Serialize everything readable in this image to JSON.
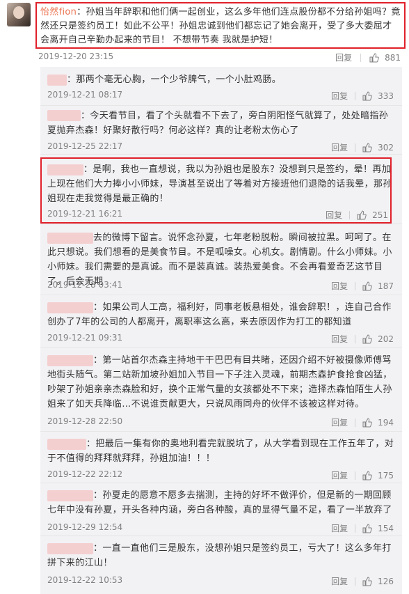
{
  "main_comment": {
    "username": "怡然fion",
    "colon": "：",
    "text": "孙姐当年辞职和他们俩一起创业，这么多年他们连点股份都不分给孙姐吗？竟然还只是签约员工！如此不公平！孙姐忠诚到他们都忘记了她会离开，受了多大委屈才会离开自己辛勤办起来的节目！ 不想带节奏 我就是护短！",
    "date": "2019-12-20 23:15",
    "reply_label": "回复",
    "likes": "881"
  },
  "replies": [
    {
      "text": "：那两个毫无心胸，一个少爷脾气，一个小肚鸡肠。",
      "date": "2019-12-21 08:17",
      "reply_label": "回复",
      "likes": "333"
    },
    {
      "text": "：今天看节目，看了个头就看不下去了，旁白阴阳怪气就算了，处处暗指孙夏抛弃杰森！好聚好散行吗？何必这样？真的让老粉太伤心了",
      "date": "2019-12-25 22:17",
      "reply_label": "回复",
      "likes": "302"
    },
    {
      "text": "：是啊，我也一直想说，我以为孙姐也是股东？没想到只是签约，晕！再加上现在他们大力捧小小师妹，导演甚至说出了等着对方接班他们退隐的话我晕，那孙姐现在走我觉得是最正确的！",
      "date": "2019-12-21 16:21",
      "reply_label": "回复",
      "likes": "251"
    },
    {
      "text": "去的微博下留言。说怀念孙夏，七年老粉脱粉。瞬间被拉黑。呵呵了。在此只想说。我们想看的是美食节目。不是呱噪女。心机女。剧情剧。什么小师妹。小小师妹。我们需要的是真诚。而不是装真诚。装热爱美食。不会再看爱奇艺这节目了。后会无期",
      "date": "2019-12-28 03:41",
      "reply_label": "回复",
      "likes": "187"
    },
    {
      "text": "：如果公司人工高，福利好，同事老板悬相处，谁会辞职！，连自己合作创办了7年的公司的人都离开，离职率这么高，来去原因作为打工的都知道",
      "date": "2019-12-21 09:31",
      "reply_label": "回复",
      "likes": "202"
    },
    {
      "text": "：第一站首尔杰森主持地干干巴巴有目共睹，还因介绍不好被摄像师傅骂地街头随气。第二站新加坡孙姐加入节目一下子注入灵魂，前期杰森护食抢食凶猛，吵架了孙姐亲亲杰森脸和好，换个正常气量的女孩都处不下来；造择杰森怕陌生人孙姐来了如天兵降临…不说谁贡献更大，只说风雨同舟的伙伴不该被这样对待。",
      "date": "2019-12-28 22:50",
      "reply_label": "回复",
      "likes": "194"
    },
    {
      "text": "：把最后一集有你的奥地利看完就脱坑了，从大学看到现在工作五年了，对于不值得的拜拜就拜拜，孙姐加油！！！",
      "date": "2019-12-22 22:12",
      "reply_label": "回复",
      "likes": "175"
    },
    {
      "text": "：孙夏走的愿意不愿多去揣测，主持的好坏不做评价，但是新的一期回顾七年中没有孙夏，开头各种内涵，旁白各种酸，真的显得气量不足，看了一半放弃了",
      "date": "2019-12-29 12:54",
      "reply_label": "回复",
      "likes": "154"
    },
    {
      "text": "：一直一直他们三是股东，没想孙姐只是签约员工，亏大了！这么多年打拼下来的江山！",
      "date": "2019-12-22 10:53",
      "reply_label": "回复",
      "likes": "126"
    }
  ]
}
